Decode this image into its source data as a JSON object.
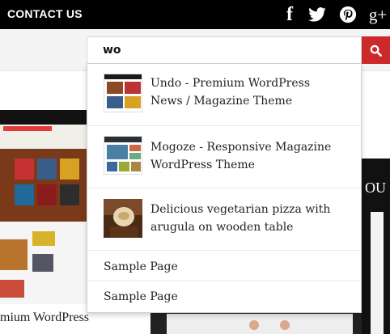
{
  "topbar": {
    "contact_label": "CONTACT US",
    "social": [
      {
        "icon": "facebook-icon",
        "glyph": "f"
      },
      {
        "icon": "twitter-icon"
      },
      {
        "icon": "pinterest-icon"
      },
      {
        "icon": "google-plus-icon",
        "glyph": "g+"
      }
    ]
  },
  "search": {
    "value": "wo",
    "button_icon": "search-icon",
    "accent": "#cc2a2a"
  },
  "results": [
    {
      "title": "Undo - Premium WordPress News / Magazine Theme",
      "thumb": "magazine-theme-thumbnail"
    },
    {
      "title": "Mogoze - Responsive Magazine WordPress Theme",
      "thumb": "magazine-theme-thumbnail"
    },
    {
      "title": "Delicious vegetarian pizza with arugula on wooden table",
      "thumb": "pizza-photo-thumbnail"
    }
  ],
  "pages": [
    {
      "title": "Sample Page"
    },
    {
      "title": "Sample Page"
    }
  ],
  "background": {
    "partial_title": "mium WordPress",
    "right_partial_text": "OU"
  }
}
